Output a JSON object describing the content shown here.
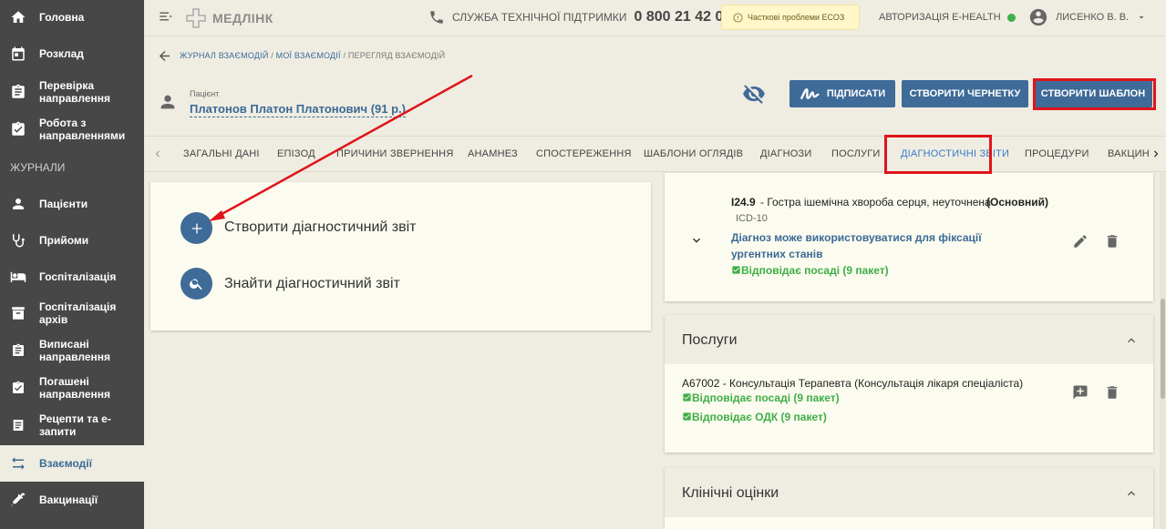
{
  "sidebar": {
    "items": [
      {
        "label": "Головна",
        "icon": "home-icon"
      },
      {
        "label": "Розклад",
        "icon": "calendar-icon"
      },
      {
        "label": "Перевірка направлення",
        "icon": "clipboard-icon"
      },
      {
        "label": "Робота з направленнями",
        "icon": "clipboard-check-icon"
      },
      {
        "label": "Пацієнти",
        "icon": "person-icon"
      },
      {
        "label": "Прийоми",
        "icon": "stethoscope-icon"
      },
      {
        "label": "Госпіталізація",
        "icon": "bed-icon"
      },
      {
        "label": "Госпіталізація архів",
        "icon": "archive-icon"
      },
      {
        "label": "Виписані направлення",
        "icon": "clipboard-icon"
      },
      {
        "label": "Погашені направлення",
        "icon": "clipboard-check-icon"
      },
      {
        "label": "Рецепти та е-запити",
        "icon": "receipt-icon"
      },
      {
        "label": "Взаємодії",
        "icon": "swap-icon"
      },
      {
        "label": "Вакцинації",
        "icon": "syringe-icon"
      }
    ],
    "section_label": "ЖУРНАЛИ",
    "active_index": 11
  },
  "topbar": {
    "logo": "МЕДЛІНК",
    "support_label": "СЛУЖБА ТЕХНІЧНОЇ ПІДТРИМКИ",
    "support_phone": "0 800 21 42 00",
    "warning": "Часткові проблеми ЕСОЗ",
    "ehealth": "АВТОРИЗАЦІЯ E-HEALTH",
    "user": "ЛИСЕНКО В. В."
  },
  "breadcrumb": {
    "items": [
      "ЖУРНАЛ ВЗАЄМОДІЙ",
      "МОЇ ВЗАЄМОДІЇ",
      "ПЕРЕГЛЯД ВЗАЄМОДІЙ"
    ],
    "separator": "/"
  },
  "patient": {
    "caption": "Пацієнт",
    "name": "Платонов Платон Платонович (91 р.)"
  },
  "actions": {
    "sign": "ПІДПИСАТИ",
    "draft": "СТВОРИТИ ЧЕРНЕТКУ",
    "template": "СТВОРИТИ ШАБЛОН"
  },
  "tabs": [
    "ЗАГАЛЬНІ ДАНІ",
    "ЕПІЗОД",
    "ПРИЧИНИ ЗВЕРНЕННЯ",
    "АНАМНЕЗ",
    "СПОСТЕРЕЖЕННЯ",
    "ШАБЛОНИ ОГЛЯДІВ",
    "ДІАГНОЗИ",
    "ПОСЛУГИ",
    "ДІАГНОСТИЧНІ ЗВІТИ",
    "ПРОЦЕДУРИ",
    "ВАКЦИН"
  ],
  "active_tab": "ДІАГНОСТИЧНІ ЗВІТИ",
  "left_panel": {
    "create": "Створити діагностичний звіт",
    "find": "Знайти діагностичний звіт"
  },
  "diagnosis": {
    "code": "I24.9",
    "text": " - Гостра ішемічна хвороба серця, неуточнена ",
    "role": "(Основний)",
    "system": "ICD-10",
    "urgent_note": "Діагноз може використовуватися для фіксації ургентних станів",
    "position_check": "Відповідає посаді (9 пакет)"
  },
  "services": {
    "title": "Послуги",
    "item": "A67002 - Консультація Терапевта (Консультація лікаря спеціаліста)",
    "check_position": "Відповідає посаді (9 пакет)",
    "check_odk": "Відповідає ОДК (9 пакет)"
  },
  "clinical": {
    "title": "Клінічні оцінки"
  },
  "colors": {
    "primary": "#3f6b98",
    "sidebar": "#474747",
    "highlight": "#e0141b",
    "ok": "#3fae47"
  }
}
